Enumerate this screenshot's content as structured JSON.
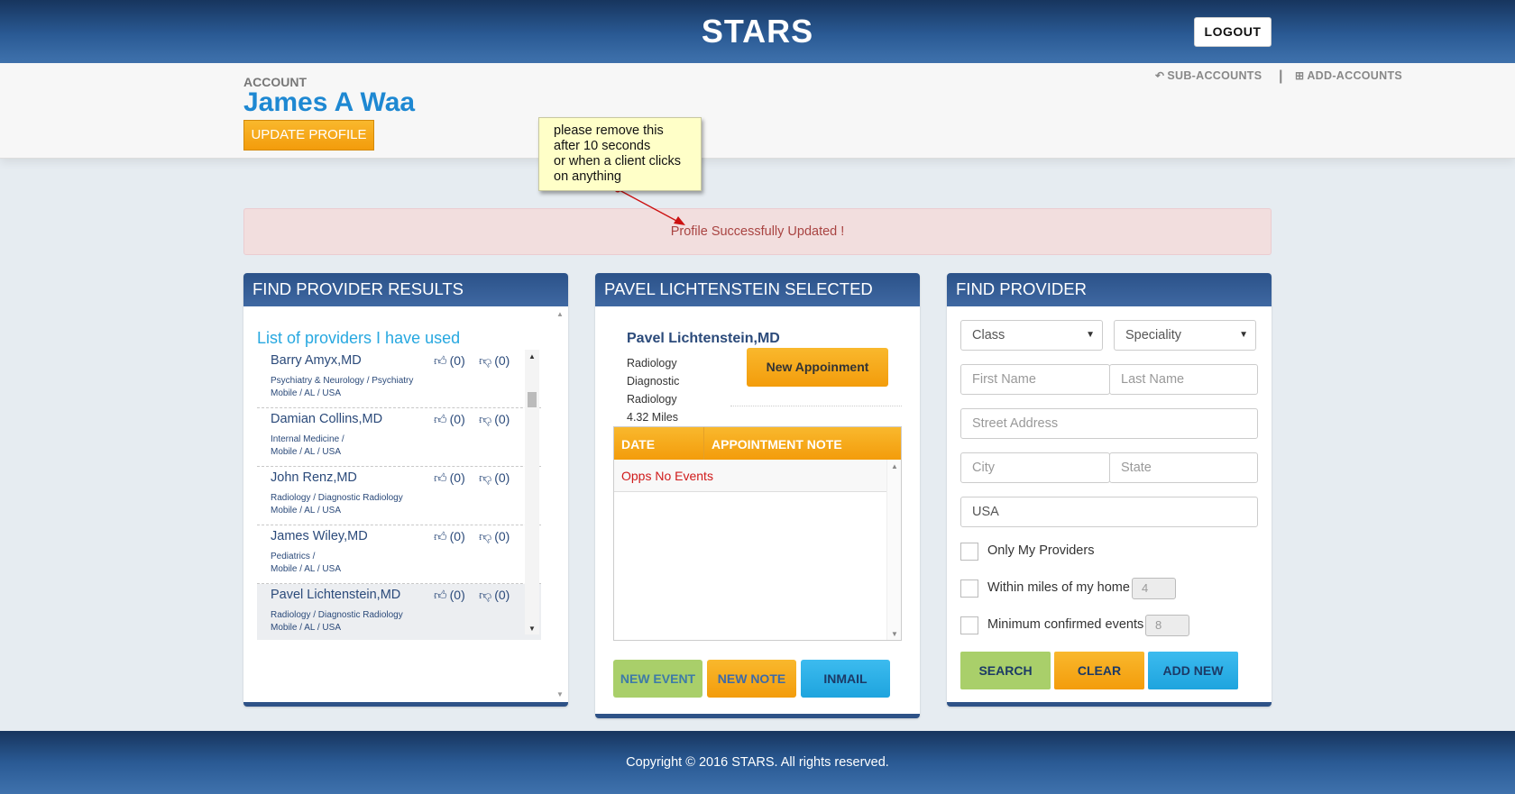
{
  "header": {
    "brand": "STARS",
    "logout_label": "LOGOUT"
  },
  "account": {
    "label": "ACCOUNT",
    "name": "James A Waa",
    "update_label": "UPDATE PROFILE",
    "links": [
      {
        "icon": "reply-icon",
        "label": "SUB-ACCOUNTS"
      },
      {
        "icon": "plus-square-icon",
        "label": "ADD-ACCOUNTS"
      }
    ],
    "separator": "|"
  },
  "note": {
    "lines": [
      "please remove this",
      "after 10 seconds",
      "or when a client clicks",
      "on anything"
    ]
  },
  "alert": {
    "message": "Profile Successfully Updated !"
  },
  "results": {
    "header": "FIND PROVIDER RESULTS",
    "list_title": "List of providers I have used",
    "providers": [
      {
        "name": "Barry Amyx,MD",
        "specialty": "Psychiatry & Neurology / Psychiatry",
        "location": "Mobile / AL / USA",
        "likes": "(0)",
        "dislikes": "(0)"
      },
      {
        "name": "Damian Collins,MD",
        "specialty": "Internal Medicine /",
        "location": "Mobile / AL / USA",
        "likes": "(0)",
        "dislikes": "(0)"
      },
      {
        "name": "John Renz,MD",
        "specialty": "Radiology / Diagnostic Radiology",
        "location": "Mobile / AL / USA",
        "likes": "(0)",
        "dislikes": "(0)"
      },
      {
        "name": "James Wiley,MD",
        "specialty": "Pediatrics /",
        "location": "Mobile / AL / USA",
        "likes": "(0)",
        "dislikes": "(0)"
      },
      {
        "name": "Pavel Lichtenstein,MD",
        "specialty": "Radiology / Diagnostic Radiology",
        "location": "Mobile / AL / USA",
        "likes": "(0)",
        "dislikes": "(0)"
      }
    ]
  },
  "selected": {
    "header": "PAVEL LICHTENSTEIN SELECTED",
    "name": "Pavel Lichtenstein,MD",
    "info": [
      "Radiology",
      "Diagnostic",
      "Radiology",
      "4.32 Miles"
    ],
    "new_appointment_label": "New Appoinment",
    "table": {
      "col_date": "DATE",
      "col_note": "APPOINTMENT NOTE",
      "empty": "Opps No Events"
    },
    "buttons": {
      "new_event": "NEW EVENT",
      "new_note": "NEW NOTE",
      "inmail": "INMAIL"
    }
  },
  "find": {
    "header": "FIND PROVIDER",
    "class_select": "Class",
    "speciality_select": "Speciality",
    "first_name_placeholder": "First Name",
    "last_name_placeholder": "Last Name",
    "street_placeholder": "Street Address",
    "city_placeholder": "City",
    "state_placeholder": "State",
    "country_value": "USA",
    "only_my": "Only My Providers",
    "within_miles": "Within miles of my home",
    "miles_value": "4",
    "min_events": "Minimum confirmed events",
    "events_value": "8",
    "buttons": {
      "search": "SEARCH",
      "clear": "CLEAR",
      "add_new": "ADD NEW"
    }
  },
  "footer": {
    "copyright": "Copyright © 2016 STARS. All rights reserved."
  },
  "colors": {
    "header_blue": "#2a5a94",
    "accent_orange": "#f39c0b",
    "link_blue": "#1e88d2",
    "alert_bg": "#f2dede",
    "green": "#a9cf6a",
    "cyan": "#29aee6"
  }
}
